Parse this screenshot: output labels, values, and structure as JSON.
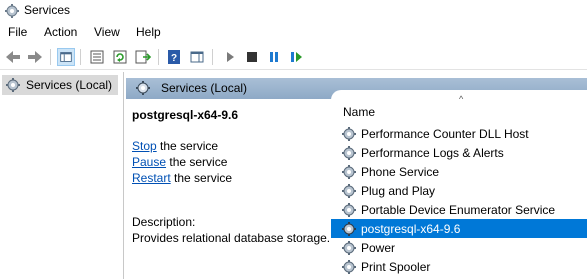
{
  "window": {
    "title": "Services"
  },
  "menu": [
    {
      "label": "File"
    },
    {
      "label": "Action"
    },
    {
      "label": "View"
    },
    {
      "label": "Help"
    }
  ],
  "toolbar": [
    {
      "icon": "back-arrow-icon"
    },
    {
      "icon": "forward-arrow-icon"
    },
    {
      "icon": "show-hide-console-tree-icon"
    },
    {
      "icon": "properties-icon"
    },
    {
      "icon": "refresh-icon"
    },
    {
      "icon": "export-list-icon"
    },
    {
      "icon": "help-icon"
    },
    {
      "icon": "action-pane-icon"
    },
    {
      "icon": "start-service-icon"
    },
    {
      "icon": "stop-service-icon"
    },
    {
      "icon": "pause-service-icon"
    },
    {
      "icon": "resume-service-icon"
    }
  ],
  "tree": {
    "root_label": "Services (Local)"
  },
  "panel": {
    "header_label": "Services (Local)"
  },
  "details": {
    "service_name": "postgresql-x64-9.6",
    "actions": [
      {
        "link": "Stop",
        "rest": " the service"
      },
      {
        "link": "Pause",
        "rest": " the service"
      },
      {
        "link": "Restart",
        "rest": " the service"
      }
    ],
    "description_label": "Description:",
    "description_text": "Provides relational database storage."
  },
  "list": {
    "column_name": "Name",
    "rows": [
      {
        "name": "Performance Counter DLL Host",
        "selected": false
      },
      {
        "name": "Performance Logs & Alerts",
        "selected": false
      },
      {
        "name": "Phone Service",
        "selected": false
      },
      {
        "name": "Plug and Play",
        "selected": false
      },
      {
        "name": "Portable Device Enumerator Service",
        "selected": false
      },
      {
        "name": "postgresql-x64-9.6",
        "selected": true
      },
      {
        "name": "Power",
        "selected": false
      },
      {
        "name": "Print Spooler",
        "selected": false
      }
    ]
  },
  "colors": {
    "selection": "#0078d7",
    "link": "#0050b4",
    "panel_header": "#9db4cf",
    "tree_selection": "#d9d9d9"
  }
}
